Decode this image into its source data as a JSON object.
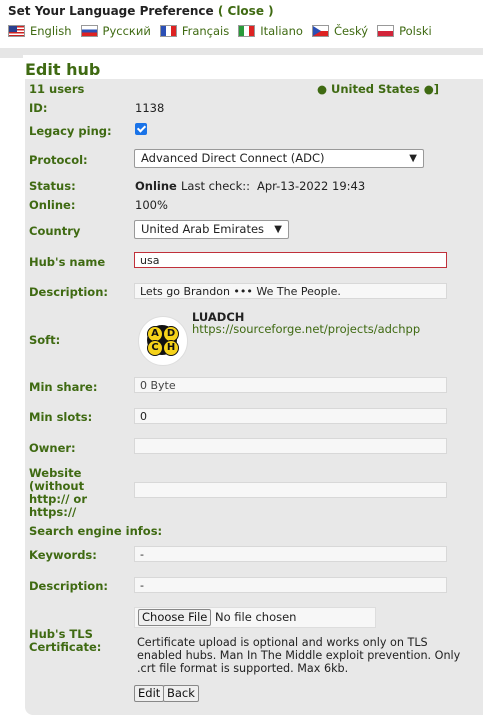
{
  "langbar": {
    "title": "Set Your Language Preference",
    "paren_open": "(",
    "close_label": "Close",
    "paren_close": ")",
    "languages": [
      "English",
      "Русский",
      "Français",
      "Italiano",
      "Český",
      "Polski"
    ]
  },
  "form": {
    "title": "Edit hub",
    "users": "11 users",
    "country_indicator": "● United States ●]",
    "id_label": "ID:",
    "id_value": "1138",
    "legacy_label": "Legacy ping:",
    "protocol_label": "Protocol:",
    "protocol_value": "Advanced Direct Connect (ADC)",
    "status_label": "Status:",
    "status_value": "Online",
    "last_check_label": "Last check::",
    "last_check_value": "Apr-13-2022 19:43",
    "online_label": "Online:",
    "online_value": "100%",
    "country_label": "Country",
    "country_value": "United Arab Emirates",
    "hub_name_label": "Hub's name",
    "hub_name_value": "usa",
    "description_label": "Description:",
    "description_value": "Lets go Brandon ••• We The People.",
    "soft_label": "Soft:",
    "soft_name": "LUADCH",
    "soft_url": "https://sourceforge.net/projects/adchpp",
    "min_share_label": "Min share:",
    "min_share_value": "0 Byte",
    "min_slots_label": "Min slots:",
    "min_slots_value": "0",
    "owner_label": "Owner:",
    "owner_value": "",
    "website_label_1": "Website",
    "website_label_2": "(without",
    "website_label_3": "http:// or",
    "website_label_4": "https://",
    "website_value": "",
    "search_infos_label": "Search engine infos:",
    "keywords_label": "Keywords:",
    "keywords_value": "-",
    "desc2_label": "Description:",
    "desc2_value": "-",
    "tls_label_1": "Hub's TLS",
    "tls_label_2": "Certificate:",
    "choose_file": "Choose File",
    "no_file": "No file chosen",
    "cert_note": "Certificate upload is optional and works only on TLS enabled hubs. Man In The Middle exploit prevention. Only .crt file format is supported. Max 6kb.",
    "edit_button": "Edit",
    "back_button": "Back"
  },
  "colors": {
    "accent": "#3f6a12",
    "panel": "#e8e8e8",
    "error_border": "#c0303a"
  },
  "icons": [
    "flag-us-icon",
    "flag-ru-icon",
    "flag-fr-icon",
    "flag-it-icon",
    "flag-cz-icon",
    "flag-pl-icon",
    "checkbox-checked-icon",
    "chevron-down-icon",
    "adc-logo-icon"
  ]
}
